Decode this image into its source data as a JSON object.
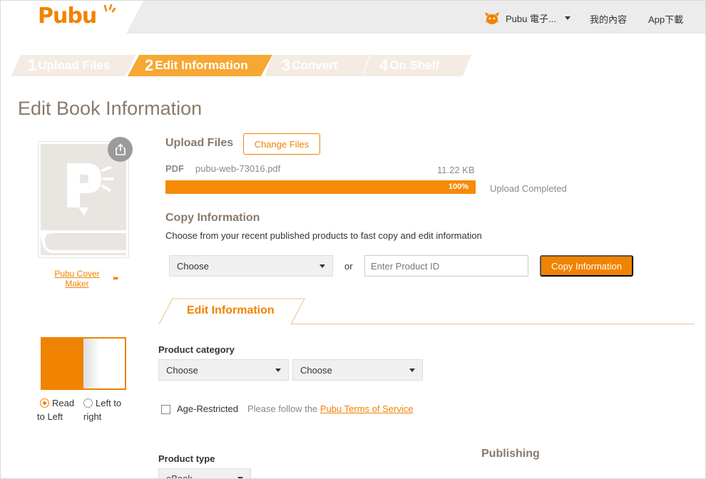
{
  "header": {
    "logo": "Pubu",
    "user_name": "Pubu 電子...",
    "nav": [
      "我的內容",
      "App下載"
    ]
  },
  "steps": [
    {
      "num": "1",
      "label": "Upload Files",
      "active": false
    },
    {
      "num": "2",
      "label": "Edit Information",
      "active": true
    },
    {
      "num": "3",
      "label": "Convert",
      "active": false
    },
    {
      "num": "4",
      "label": "On Shelf",
      "active": false
    }
  ],
  "page_title": "Edit Book Information",
  "cover": {
    "share_icon": "share-icon",
    "maker_link": "Pubu Cover Maker",
    "maker_arrows": "▸▸"
  },
  "direction": {
    "rtl_label": "Read to Left",
    "ltr_label": "Left to right",
    "selected": "rtl"
  },
  "upload": {
    "title": "Upload Files",
    "change_button": "Change Files",
    "file_type": "PDF",
    "file_name": "pubu-web-73016.pdf",
    "file_size": "11.22 KB",
    "progress": 100,
    "progress_label": "100%",
    "status": "Upload Completed"
  },
  "copy": {
    "title": "Copy Information",
    "description": "Choose from your recent published products to fast copy and edit information",
    "select_value": "Choose",
    "or_label": "or",
    "product_id_placeholder": "Enter Product ID",
    "copy_button": "Copy Information"
  },
  "edit_tab": {
    "label": "Edit Information"
  },
  "product_category": {
    "label": "Product category",
    "select1": "Choose",
    "select2": "Choose"
  },
  "age": {
    "label": "Age-Restricted",
    "note_prefix": "Please follow the ",
    "terms_link": "Pubu Terms of Service"
  },
  "product_type": {
    "label": "Product type",
    "value": "eBook"
  },
  "publishing": {
    "title": "Publishing"
  },
  "colors": {
    "accent": "#f08300",
    "step_active": "#f7a733",
    "step_inactive": "#f4ece3",
    "title_brown": "#8a7a6a"
  }
}
